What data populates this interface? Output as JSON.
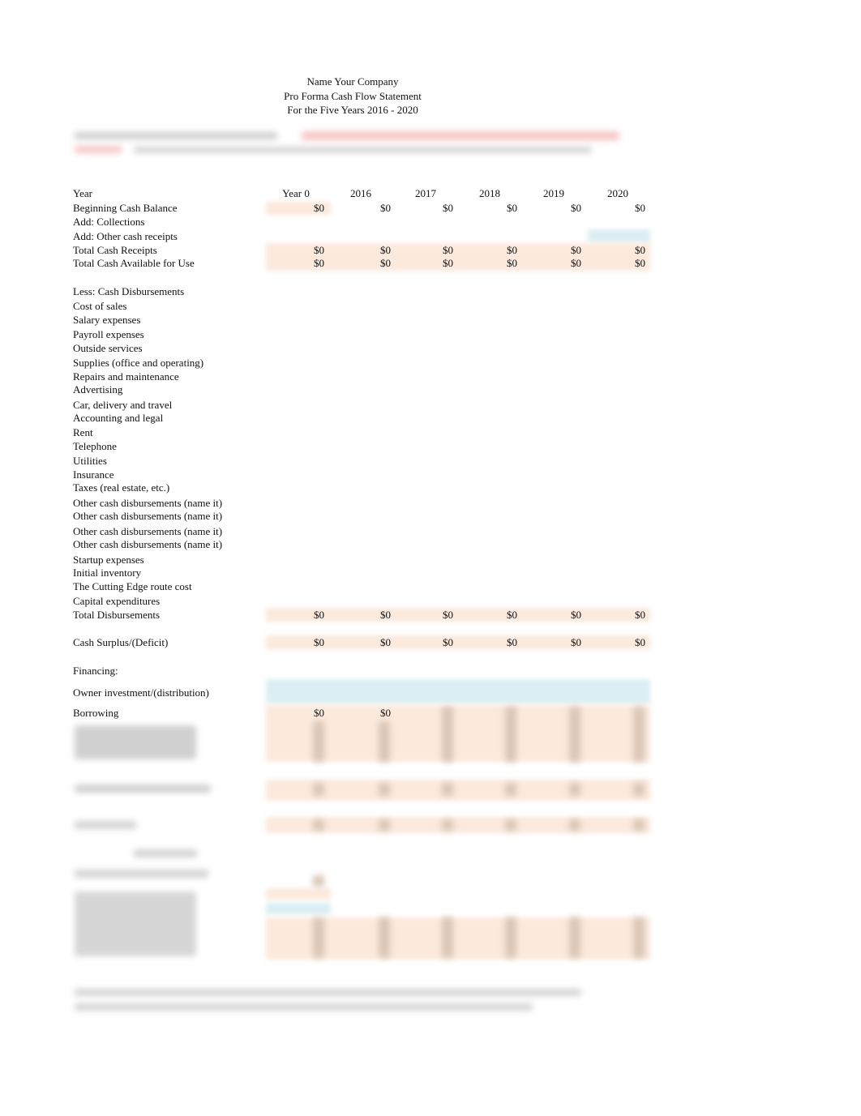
{
  "header": {
    "company": "Name Your Company",
    "statement": "Pro Forma Cash Flow Statement",
    "period": "For the Five Years 2016 - 2020"
  },
  "colors": {
    "calc_cell": "#fbe9dc",
    "input_cell": "#daeef3",
    "note_red": "#f7c6c6"
  },
  "table": {
    "year_label": "Year",
    "columns": [
      "Year 0",
      "2016",
      "2017",
      "2018",
      "2019",
      "2020"
    ],
    "receipts": [
      {
        "label": "Beginning Cash Balance",
        "values": [
          "$0",
          "$0",
          "$0",
          "$0",
          "$0",
          "$0"
        ]
      },
      {
        "label": "Add: Collections",
        "values": [
          "",
          "",
          "",
          "",
          "",
          ""
        ]
      },
      {
        "label": "Add: Other cash receipts",
        "values": [
          "",
          "",
          "",
          "",
          "",
          ""
        ]
      },
      {
        "label": "Total Cash Receipts",
        "values": [
          "$0",
          "$0",
          "$0",
          "$0",
          "$0",
          "$0"
        ]
      },
      {
        "label": "Total Cash Available for Use",
        "values": [
          "$0",
          "$0",
          "$0",
          "$0",
          "$0",
          "$0"
        ]
      }
    ],
    "disbursements_heading": "Less: Cash Disbursements",
    "disbursements": [
      "Cost of sales",
      "Salary expenses",
      "Payroll expenses",
      "Outside services",
      "Supplies (office and operating)",
      "Repairs and maintenance",
      "Advertising",
      "Car, delivery and travel",
      "Accounting and legal",
      "Rent",
      "Telephone",
      "Utilities",
      "Insurance",
      "Taxes (real estate, etc.)",
      "Other cash disbursements (name it)",
      "Other cash disbursements (name it)",
      "Other cash disbursements (name it)",
      "Other cash disbursements (name it)",
      "Startup expenses",
      "Initial inventory",
      "The Cutting Edge route cost",
      "Capital expenditures"
    ],
    "total_disbursements": {
      "label": "Total Disbursements",
      "values": [
        "$0",
        "$0",
        "$0",
        "$0",
        "$0",
        "$0"
      ]
    },
    "surplus": {
      "label": "Cash Surplus/(Deficit)",
      "values": [
        "$0",
        "$0",
        "$0",
        "$0",
        "$0",
        "$0"
      ]
    },
    "financing_heading": "Financing:",
    "owner_investment": {
      "label": "Owner investment/(distribution)"
    },
    "borrowing": {
      "label": "Borrowing",
      "values": [
        "$0",
        "$0"
      ]
    }
  }
}
